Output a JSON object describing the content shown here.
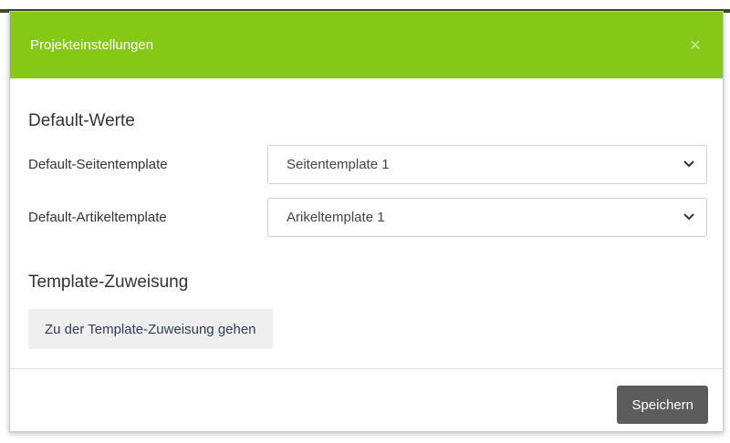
{
  "modal": {
    "title": "Projekteinstellungen",
    "close_glyph": "×",
    "colors": {
      "header": "#86c816",
      "save_button": "#5c5c5c"
    }
  },
  "defaults_section": {
    "title": "Default-Werte",
    "page_template": {
      "label": "Default-Seitentemplate",
      "value": "Seitentemplate 1"
    },
    "article_template": {
      "label": "Default-Artikeltemplate",
      "value": "Arikeltemplate 1"
    }
  },
  "assignment_section": {
    "title": "Template-Zuweisung",
    "button_label": "Zu der Template-Zuweisung gehen"
  },
  "footer": {
    "save_label": "Speichern"
  },
  "icons": {
    "close": "close-icon",
    "dropdown": "chevron-down-icon"
  }
}
